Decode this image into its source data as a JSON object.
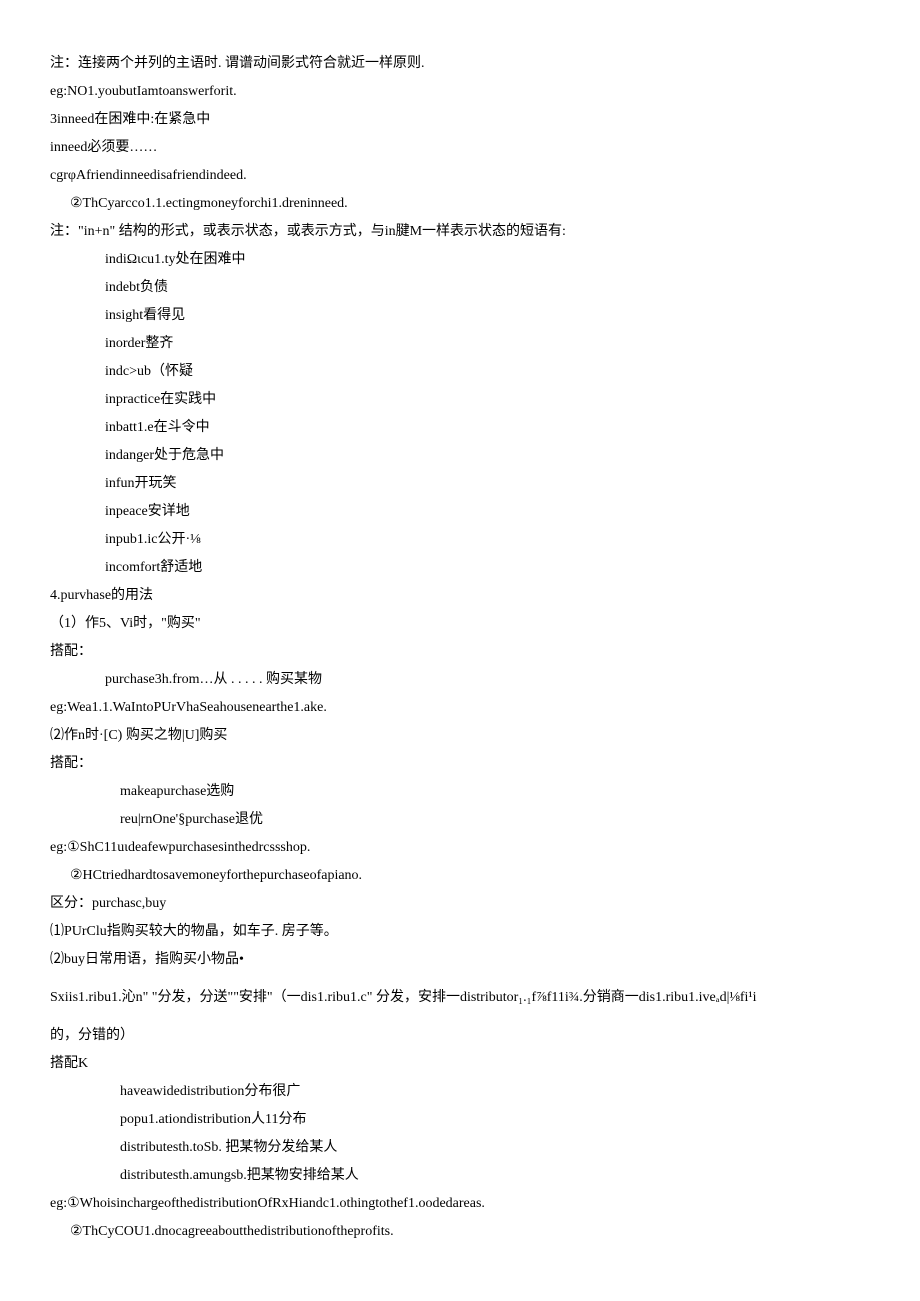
{
  "lines": [
    {
      "cls": "",
      "text": "注：连接两个并列的主语时. 谓谱动间影式符合就近一样原则."
    },
    {
      "cls": "",
      "text": "eg:NO1.youbutIamtoanswerforit."
    },
    {
      "cls": "",
      "text": "3inneed在困难中:在紧急中"
    },
    {
      "cls": "",
      "text": "inneed必须要……"
    },
    {
      "cls": "",
      "text": "cgrφAfriendinneedisafriendindeed."
    },
    {
      "cls": "indent1",
      "text": "②ThCyarcco1.1.ectingmoneyforchi1.dreninneed."
    },
    {
      "cls": "",
      "text": "注：\"in+n\" 结构的形式，或表示状态，或表示方式，与in腱M一样表示状态的短语有:"
    },
    {
      "cls": "indent2",
      "text": "indiΩιcu1.ty处在困难中"
    },
    {
      "cls": "indent2",
      "text": "indebt负债"
    },
    {
      "cls": "indent2",
      "text": "insight看得见"
    },
    {
      "cls": "indent2",
      "text": "inorder整齐"
    },
    {
      "cls": "indent2",
      "text": "indc>ub（怀疑"
    },
    {
      "cls": "indent2",
      "text": "inpractice在实践中"
    },
    {
      "cls": "indent2",
      "text": "inbatt1.e在斗令中"
    },
    {
      "cls": "indent2",
      "text": "indanger处于危急中"
    },
    {
      "cls": "indent2",
      "text": "infun开玩笑"
    },
    {
      "cls": "indent2",
      "text": "inpeace安详地"
    },
    {
      "cls": "indent2",
      "text": "inpub1.ic公开·⅛"
    },
    {
      "cls": "indent2",
      "text": "incomfort舒适地"
    },
    {
      "cls": "",
      "text": "4.purvhase的用法"
    },
    {
      "cls": "",
      "text": "（1）作5、Vi时，\"购买\""
    },
    {
      "cls": "",
      "text": "搭配："
    },
    {
      "cls": "indent2",
      "text": "purchase3h.from…从 . . . . . 购买某物"
    },
    {
      "cls": "",
      "text": "eg:Wea1.1.WaIntoPUrVhaSeahousenearthe1.ake."
    },
    {
      "cls": "",
      "text": "⑵作n时·[C) 购买之物|U]购买"
    },
    {
      "cls": "",
      "text": "搭配："
    },
    {
      "cls": "indent3",
      "text": "makeapurchase选购"
    },
    {
      "cls": "indent3",
      "text": "reu|rnOne'§purchase退优"
    },
    {
      "cls": "",
      "text": "eg:①ShC11uιdeafewpurchasesinthedrcssshop."
    },
    {
      "cls": "indent1",
      "text": "②HCtriedhardtosavemoneyforthepurchaseofapiano."
    },
    {
      "cls": "",
      "text": "区分：purchasc,buy"
    },
    {
      "cls": "",
      "text": "⑴PUrClu指购买较大的物晶，如车子. 房子等。"
    },
    {
      "cls": "",
      "text": "⑵buy日常用语，指购买小物品•"
    },
    {
      "cls": "spaced",
      "text": "Sxiis1.ribu1.沁n\" \"分发，分送\"\"安排\"（一dis1.ribu1.c\" 分发，安排一distributor₁.₁f⅞f11i¾.分销商一dis1.ribu1.iveₐd|⅛fi¹i"
    },
    {
      "cls": "spaced",
      "text": "的，分错的）"
    },
    {
      "cls": "",
      "text": "搭配K"
    },
    {
      "cls": "indent3",
      "text": "haveawidedistribution分布很广"
    },
    {
      "cls": "indent3",
      "text": "popu1.ationdistribution人11分布"
    },
    {
      "cls": "indent3",
      "text": "distributesth.toSb. 把某物分发给某人"
    },
    {
      "cls": "indent3",
      "text": "distributesth.amungsb.把某物安排给某人"
    },
    {
      "cls": "",
      "text": "eg:①WhoisinchargeofthedistributionOfRxHiandc1.othingtothef1.oodedareas."
    },
    {
      "cls": "indent1",
      "text": "②ThCyCOU1.dnocagreeaboutthedistributionoftheprofits."
    }
  ]
}
